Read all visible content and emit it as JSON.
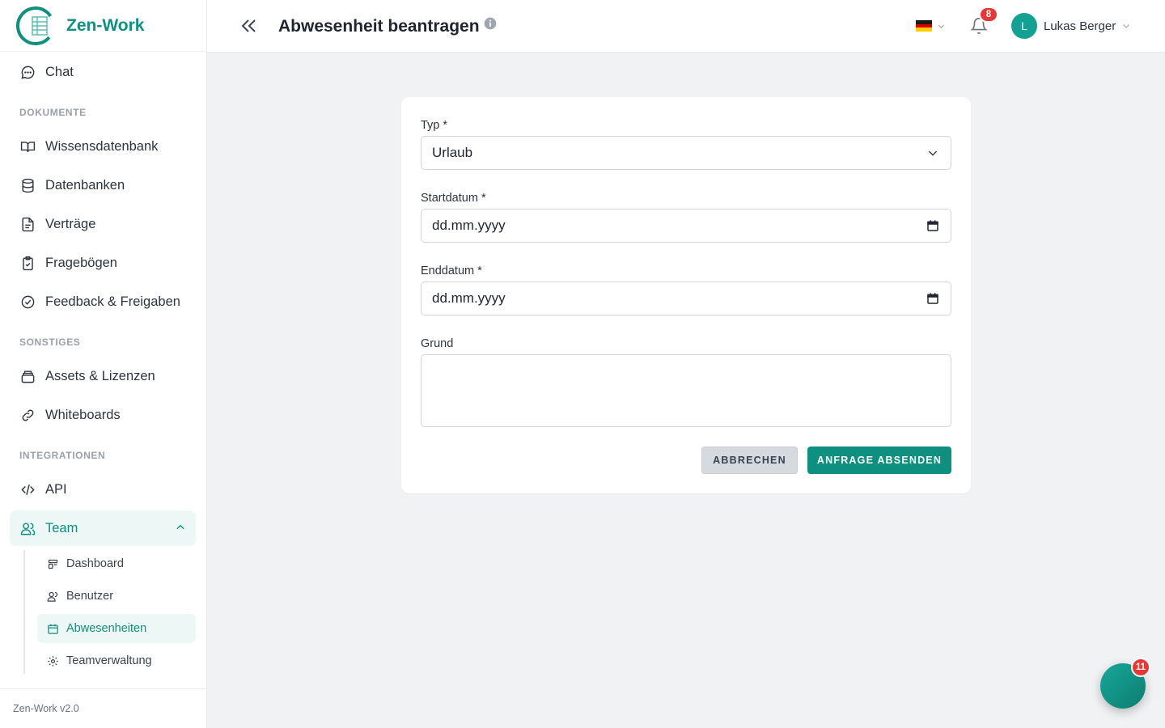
{
  "app": {
    "name": "Zen-Work",
    "version": "Zen-Work v2.0"
  },
  "sidebar": {
    "chat": "Chat",
    "sections": {
      "documents": "DOKUMENTE",
      "misc": "SONSTIGES",
      "integrations": "INTEGRATIONEN"
    },
    "items": {
      "knowledge": "Wissensdatenbank",
      "databases": "Datenbanken",
      "contracts": "Verträge",
      "questionnaires": "Fragebögen",
      "feedback": "Feedback & Freigaben",
      "assets": "Assets & Lizenzen",
      "whiteboards": "Whiteboards",
      "api": "API",
      "team": "Team"
    },
    "team_sub": {
      "dashboard": "Dashboard",
      "users": "Benutzer",
      "absences": "Abwesenheiten",
      "team_admin": "Teamverwaltung"
    }
  },
  "header": {
    "title": "Abwesenheit beantragen",
    "notification_count": "8",
    "user_initial": "L",
    "user_name": "Lukas Berger",
    "language_flag": "de"
  },
  "form": {
    "type_label": "Typ *",
    "type_value": "Urlaub",
    "start_label": "Startdatum *",
    "start_placeholder": "dd.mm.yyyy",
    "end_label": "Enddatum *",
    "end_placeholder": "dd.mm.yyyy",
    "reason_label": "Grund",
    "reason_value": "",
    "cancel_label": "ABBRECHEN",
    "submit_label": "ANFRAGE ABSENDEN"
  },
  "chat_fab": {
    "badge": "11"
  },
  "colors": {
    "accent": "#0f8f80",
    "badge": "#e53935",
    "background": "#f1f2f4"
  }
}
